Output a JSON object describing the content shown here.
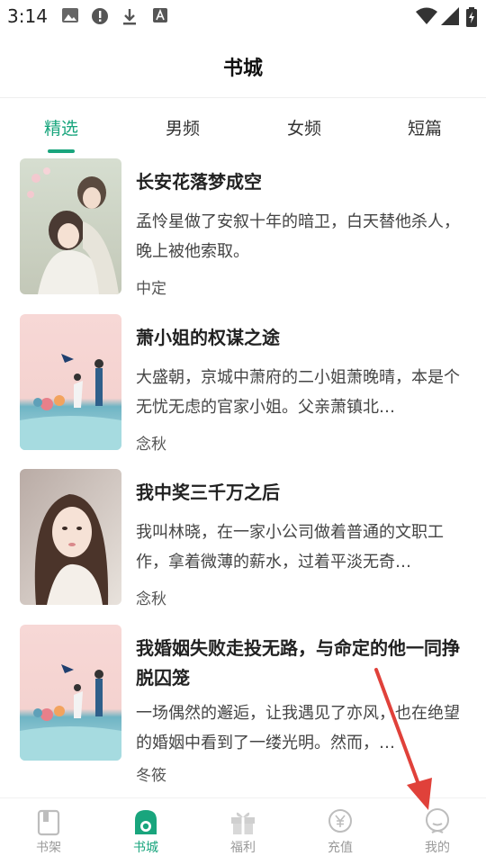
{
  "status_bar": {
    "time": "3:14"
  },
  "header": {
    "title": "书城"
  },
  "tabs": [
    {
      "label": "精选",
      "active": true
    },
    {
      "label": "男频"
    },
    {
      "label": "女频"
    },
    {
      "label": "短篇"
    }
  ],
  "books": [
    {
      "title": "长安花落梦成空",
      "description": "孟怜星做了安叙十年的暗卫，白天替他杀人，晚上被他索取。",
      "author": "中定"
    },
    {
      "title": "萧小姐的权谋之途",
      "description": "大盛朝，京城中萧府的二小姐萧晚晴，本是个无忧无虑的官家小姐。父亲萧镇北…",
      "author": "念秋"
    },
    {
      "title": "我中奖三千万之后",
      "description": "我叫林晓，在一家小公司做着普通的文职工作，拿着微薄的薪水，过着平淡无奇…",
      "author": "念秋"
    },
    {
      "title": "我婚姻失败走投无路，与命定的他一同挣脱囚笼",
      "description": "一场偶然的邂逅，让我遇见了亦风，也在绝望的婚姻中看到了一缕光明。然而，…",
      "author": "冬筱"
    }
  ],
  "bottom_nav": [
    {
      "label": "书架",
      "icon": "bookshelf-icon"
    },
    {
      "label": "书城",
      "icon": "bookstore-icon",
      "active": true
    },
    {
      "label": "福利",
      "icon": "gift-icon"
    },
    {
      "label": "充值",
      "icon": "recharge-icon"
    },
    {
      "label": "我的",
      "icon": "profile-icon"
    }
  ],
  "colors": {
    "accent": "#19a57d",
    "annotation_arrow": "#e0413a"
  }
}
